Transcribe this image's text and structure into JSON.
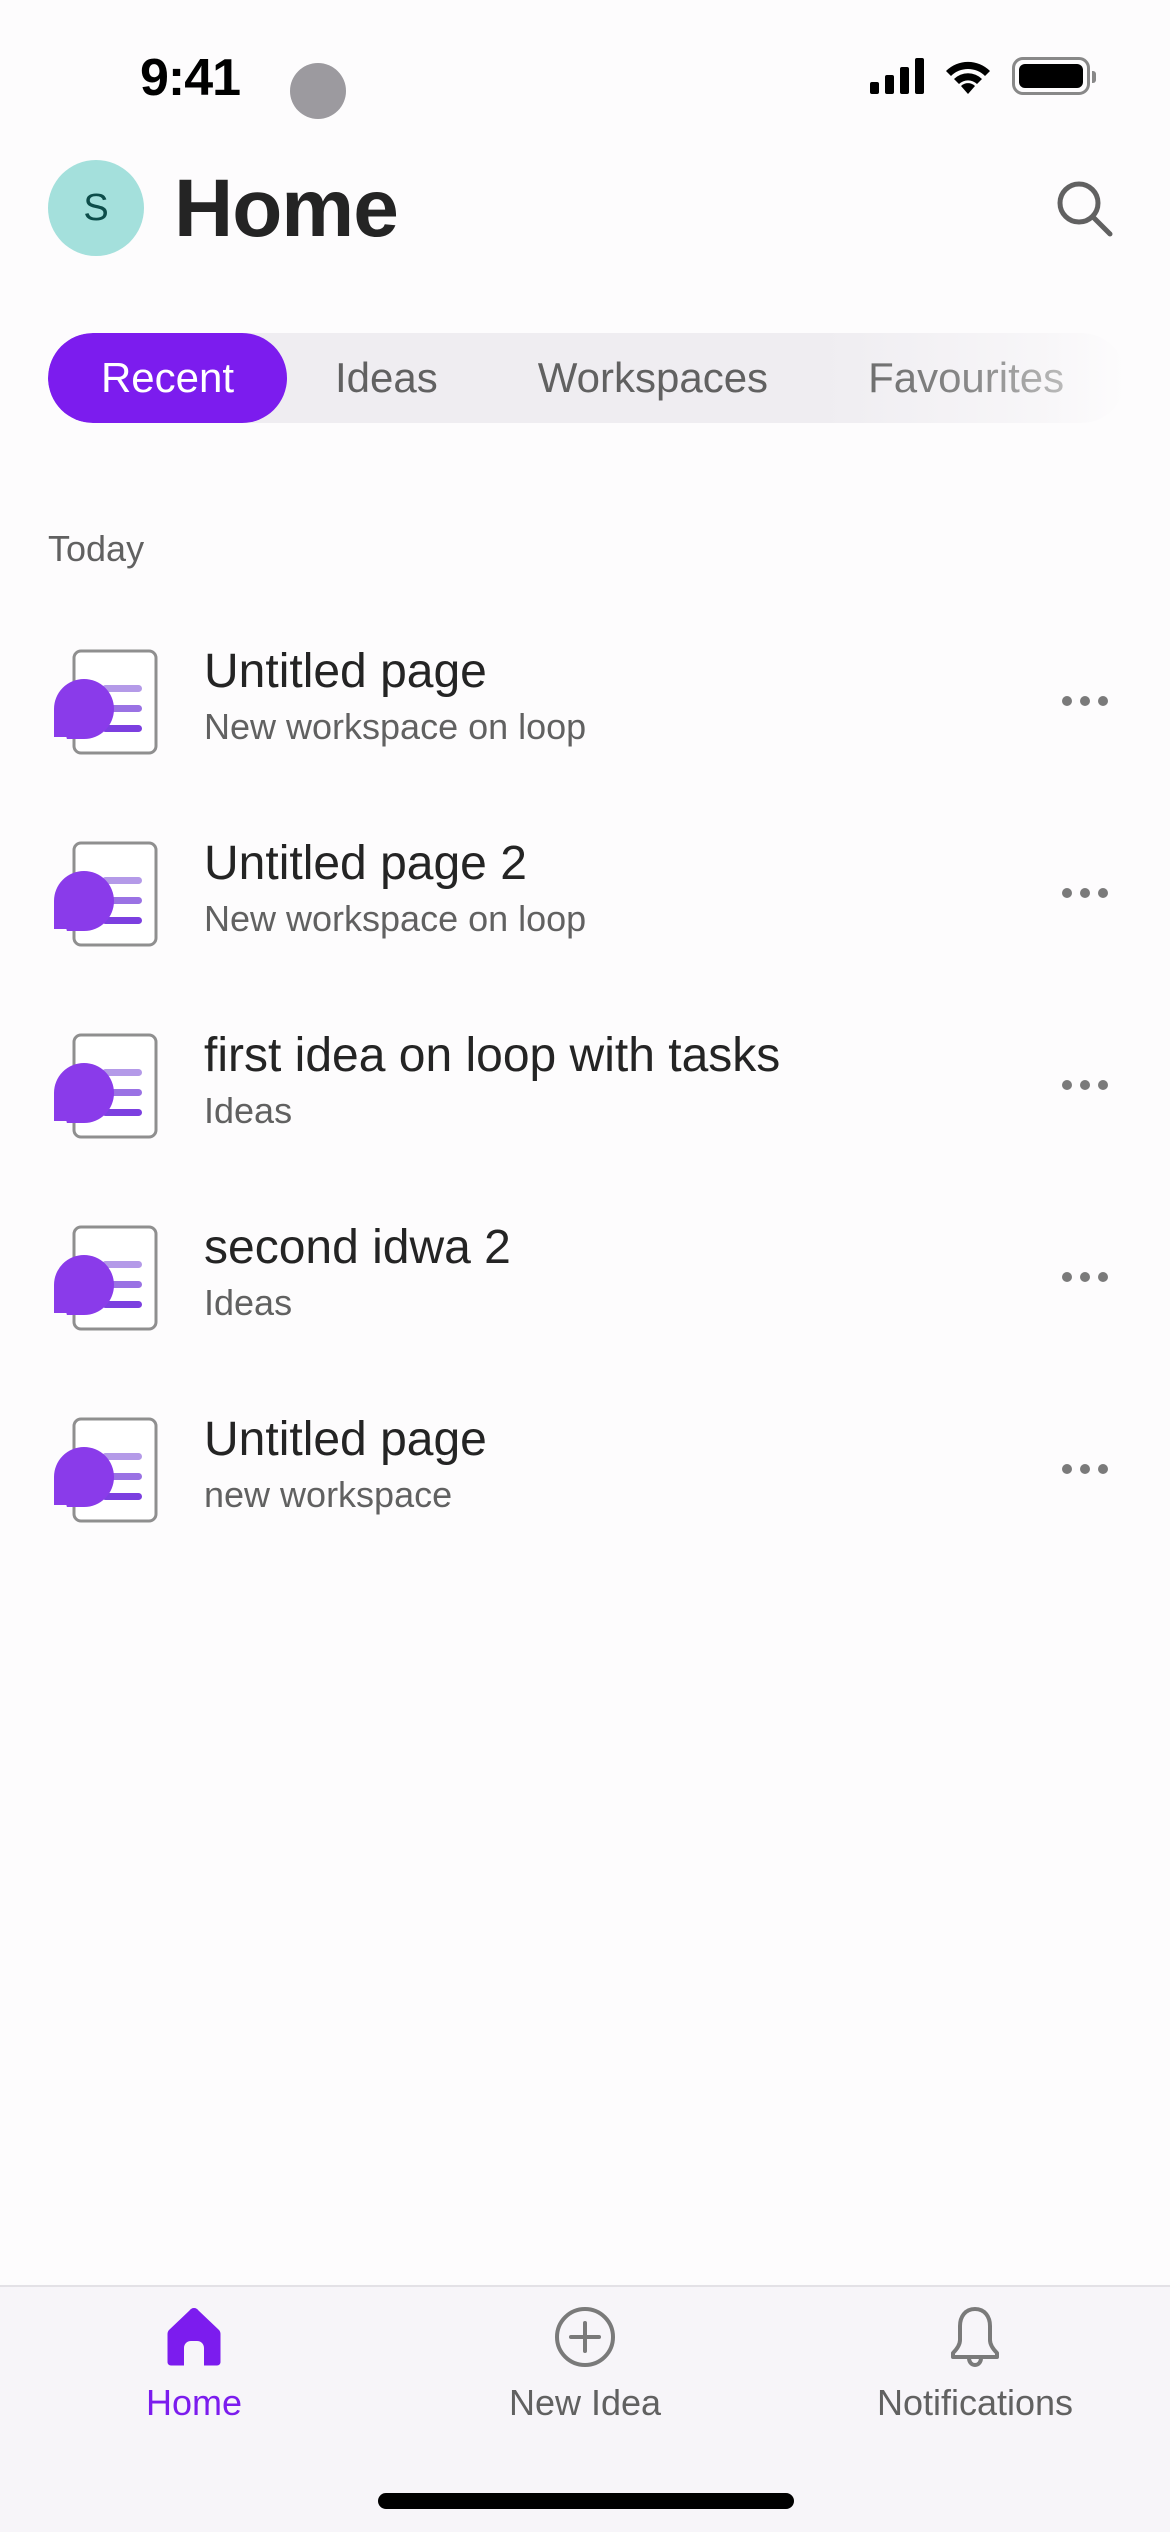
{
  "status_bar": {
    "time": "9:41",
    "icons": [
      "cellular-signal-icon",
      "wifi-icon",
      "battery-icon"
    ]
  },
  "header": {
    "avatar_initial": "S",
    "title": "Home",
    "search_icon": "search-icon"
  },
  "filter_tabs": [
    {
      "label": "Recent",
      "active": true
    },
    {
      "label": "Ideas",
      "active": false
    },
    {
      "label": "Workspaces",
      "active": false
    },
    {
      "label": "Favourites",
      "active": false
    }
  ],
  "section": {
    "label": "Today"
  },
  "items": [
    {
      "title": "Untitled page",
      "subtitle": "New workspace on loop",
      "icon": "loop-page-icon",
      "menu_icon": "more-horizontal-icon"
    },
    {
      "title": "Untitled page 2",
      "subtitle": "New workspace on loop",
      "icon": "loop-page-icon",
      "menu_icon": "more-horizontal-icon"
    },
    {
      "title": "first idea on loop with tasks",
      "subtitle": "Ideas",
      "icon": "loop-page-icon",
      "menu_icon": "more-horizontal-icon"
    },
    {
      "title": "second idwa 2",
      "subtitle": "Ideas",
      "icon": "loop-page-icon",
      "menu_icon": "more-horizontal-icon"
    },
    {
      "title": "Untitled page",
      "subtitle": "new workspace",
      "icon": "loop-page-icon",
      "menu_icon": "more-horizontal-icon"
    }
  ],
  "bottom_nav": [
    {
      "label": "Home",
      "icon": "home-icon",
      "active": true
    },
    {
      "label": "New Idea",
      "icon": "add-circle-icon",
      "active": false
    },
    {
      "label": "Notifications",
      "icon": "bell-icon",
      "active": false
    }
  ],
  "colors": {
    "accent": "#7c1cee",
    "avatar_bg": "#a4e0dc",
    "avatar_text": "#0d4d4a",
    "secondary_text": "#616161",
    "tab_track": "#efedf1"
  }
}
